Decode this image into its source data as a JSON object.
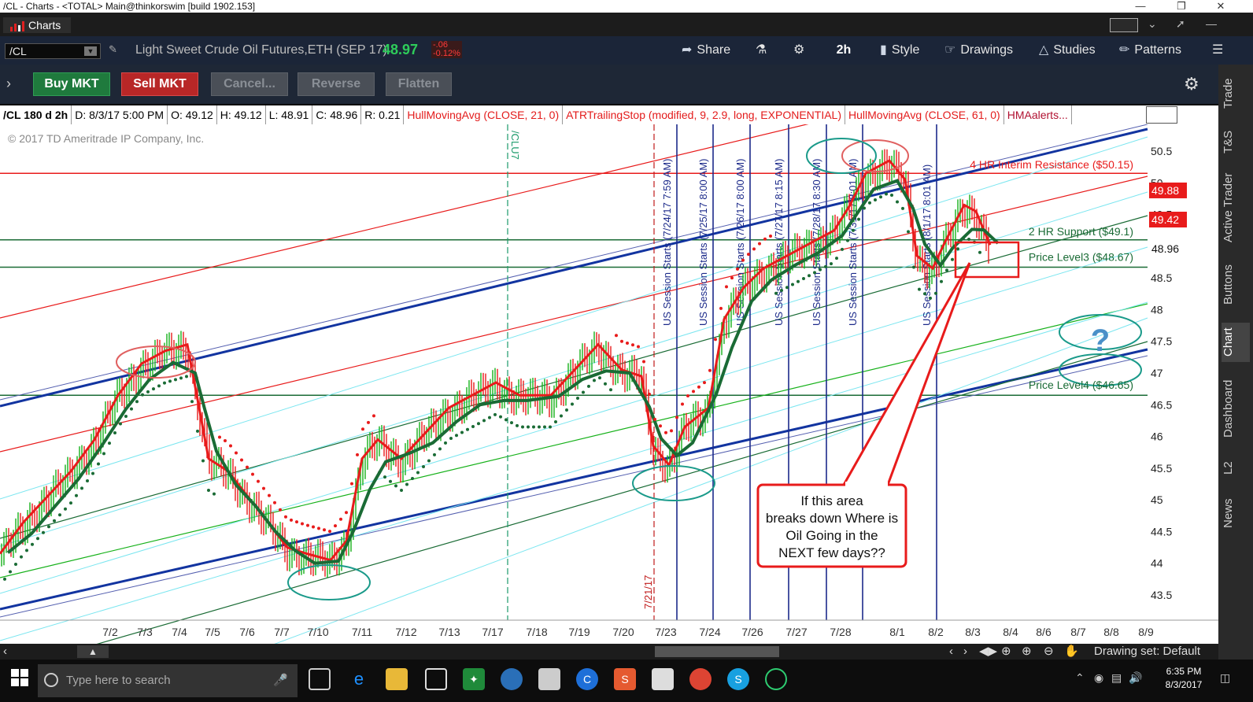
{
  "window": {
    "title": "/CL - Charts - <TOTAL> Main@thinkorswim [build 1902.153]"
  },
  "tabs": {
    "charts_label": "Charts"
  },
  "toolbar": {
    "symbol": "/CL",
    "description": "Light Sweet Crude Oil Futures,ETH (SEP 17)",
    "last": "48.97",
    "change": "-.06",
    "change_pct": "-0.12%",
    "share": "Share",
    "aggregation": "2h",
    "style": "Style",
    "drawings": "Drawings",
    "studies": "Studies",
    "patterns": "Patterns"
  },
  "actions": {
    "buy": "Buy MKT",
    "sell": "Sell MKT",
    "cancel": "Cancel...",
    "reverse": "Reverse",
    "flatten": "Flatten"
  },
  "info": {
    "symbol": "/CL 180 d 2h",
    "date": "D: 8/3/17 5:00 PM",
    "open": "O: 49.12",
    "high": "H: 49.12",
    "low": "L: 48.91",
    "close": "C: 48.96",
    "range": "R: 0.21",
    "study1": "HullMovingAvg (CLOSE, 21, 0)",
    "study2": "ATRTrailingStop (modified, 9, 2.9, long, EXPONENTIAL)",
    "study3": "HullMovingAvg (CLOSE, 61, 0)",
    "study4": "HMAalerts..."
  },
  "chart": {
    "copyright": "2017 © TD Ameritrade IP Company, Inc.",
    "y_ticks": [
      "50.5",
      "50",
      "49.5",
      "49",
      "48.5",
      "48",
      "47.5",
      "47",
      "46.5",
      "46",
      "45.5",
      "45",
      "44.5",
      "44",
      "43.5"
    ],
    "x_ticks": [
      "7/2",
      "7/3",
      "7/4",
      "7/5",
      "7/6",
      "7/7",
      "7/10",
      "7/11",
      "7/12",
      "7/13",
      "7/17",
      "7/18",
      "7/19",
      "7/20",
      "7/23",
      "7/24",
      "7/26",
      "7/27",
      "7/28",
      "8/1",
      "8/2",
      "8/3",
      "8/4",
      "8/6",
      "8/7",
      "8/8",
      "8/9"
    ],
    "price_labels": {
      "hma_fast": "49.88",
      "hma_slow": "49.42",
      "last": "48.96"
    },
    "annotations": {
      "resistance": "4 HR Interim Resistance ($50.15)",
      "support": "2 HR Support ($49.1)",
      "level3": "Price Level3 ($48.67)",
      "level4": "Price Level4 ($46.65)",
      "question": "?",
      "callout": "If this area breaks down Where is Oil Going in the NEXT few days??"
    },
    "markers": {
      "cl_u7": "/CLU7",
      "date_721": "7/21/17",
      "sessions": [
        "US Session Starts (7/24/17 7:59 AM)",
        "US Session Starts (7/25/17 8:00 AM)",
        "US Session Starts (7/26/17 8:00 AM)",
        "US Session Starts (7/27/17 8:15 AM)",
        "US Session Starts (7/28/17 8:30 AM)",
        "US Session Starts (7/31/17 8:01 AM)",
        "US Session Starts (8/1/17 8:01 AM)"
      ]
    },
    "colors": {
      "bull": "#16b11a",
      "bear": "#e81b1b",
      "hma_fast": "#e81b1b",
      "hma_slow": "#1a6b35",
      "channel": "#1234a0",
      "resistance": "#e81b1b",
      "support": "#1a6b35",
      "highlight": "#1a9a8a"
    }
  },
  "bottom": {
    "drawing_set": "Drawing set: Default"
  },
  "side_tabs": [
    "Trade",
    "T&S",
    "Active Trader",
    "Buttons",
    "Chart",
    "Dashboard",
    "L2",
    "News"
  ],
  "taskbar": {
    "search_placeholder": "Type here to search",
    "time": "6:35 PM",
    "date": "8/3/2017"
  }
}
